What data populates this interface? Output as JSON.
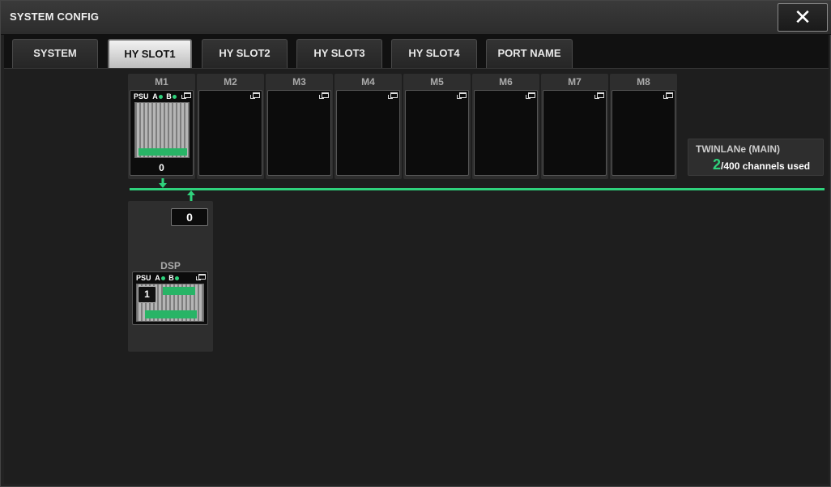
{
  "window": {
    "title": "SYSTEM CONFIG",
    "close_label": "✕"
  },
  "tabs": [
    {
      "label": "SYSTEM",
      "active": false
    },
    {
      "label": "HY SLOT1",
      "active": true
    },
    {
      "label": "HY SLOT2",
      "active": false
    },
    {
      "label": "HY SLOT3",
      "active": false
    },
    {
      "label": "HY SLOT4",
      "active": false
    },
    {
      "label": "PORT NAME",
      "active": false
    }
  ],
  "modules": [
    {
      "label": "M1",
      "populated": true,
      "count": "0",
      "psu": "PSU",
      "a": "A",
      "b": "B"
    },
    {
      "label": "M2",
      "populated": false
    },
    {
      "label": "M3",
      "populated": false
    },
    {
      "label": "M4",
      "populated": false
    },
    {
      "label": "M5",
      "populated": false
    },
    {
      "label": "M6",
      "populated": false
    },
    {
      "label": "M7",
      "populated": false
    },
    {
      "label": "M8",
      "populated": false
    }
  ],
  "twinlane": {
    "title": "TWINLANe (MAIN)",
    "used": "2",
    "suffix": "/400 channels used"
  },
  "dsp": {
    "count": "0",
    "label": "DSP",
    "unit_id": "1",
    "psu": "PSU",
    "a": "A",
    "b": "B"
  },
  "colors": {
    "accent": "#2fd27c",
    "active_tab": "#e0e0e0"
  }
}
